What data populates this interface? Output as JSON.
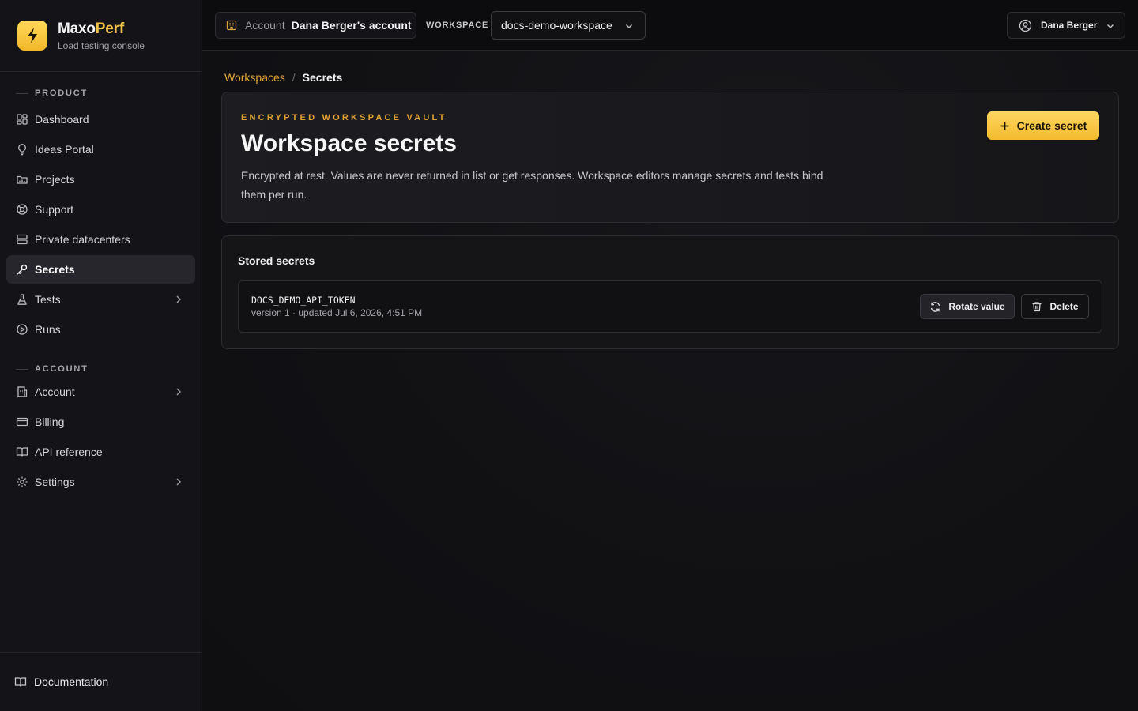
{
  "brand": {
    "name_part1": "Maxo",
    "name_part2": "Perf",
    "subtitle": "Load testing console",
    "accent_color": "#f5c343"
  },
  "sidebar": {
    "sections": [
      {
        "label": "PRODUCT"
      },
      {
        "label": "ACCOUNT"
      }
    ],
    "items": [
      {
        "label": "Dashboard",
        "icon": "dashboard-icon"
      },
      {
        "label": "Ideas Portal",
        "icon": "lightbulb-icon"
      },
      {
        "label": "Projects",
        "icon": "folder-icon"
      },
      {
        "label": "Support",
        "icon": "lifebuoy-icon"
      },
      {
        "label": "Private datacenters",
        "icon": "server-icon"
      },
      {
        "label": "Secrets",
        "icon": "key-icon",
        "active": true
      },
      {
        "label": "Tests",
        "icon": "flask-icon",
        "expandable": true
      },
      {
        "label": "Runs",
        "icon": "play-circle-icon"
      },
      {
        "label": "Account",
        "icon": "building-icon",
        "expandable": true
      },
      {
        "label": "Billing",
        "icon": "credit-card-icon"
      },
      {
        "label": "API reference",
        "icon": "book-icon"
      },
      {
        "label": "Settings",
        "icon": "gear-icon",
        "expandable": true
      }
    ],
    "footer": {
      "label": "Documentation",
      "icon": "book-open-icon"
    }
  },
  "topbar": {
    "account_label": "Account",
    "account_value": "Dana Berger's account",
    "workspace_label": "WORKSPACE",
    "workspace_value": "docs-demo-workspace",
    "user_name": "Dana Berger"
  },
  "breadcrumb": {
    "parent": "Workspaces",
    "separator": "/",
    "current": "Secrets"
  },
  "hero": {
    "eyebrow": "ENCRYPTED WORKSPACE VAULT",
    "title": "Workspace secrets",
    "description": "Encrypted at rest. Values are never returned in list or get responses. Workspace editors manage secrets and tests bind them per run.",
    "create_button": "Create secret"
  },
  "stored": {
    "title": "Stored secrets",
    "secrets": [
      {
        "name": "DOCS_DEMO_API_TOKEN",
        "meta": "version 1 · updated Jul 6, 2026, 4:51 PM",
        "rotate_label": "Rotate value",
        "delete_label": "Delete"
      }
    ]
  }
}
